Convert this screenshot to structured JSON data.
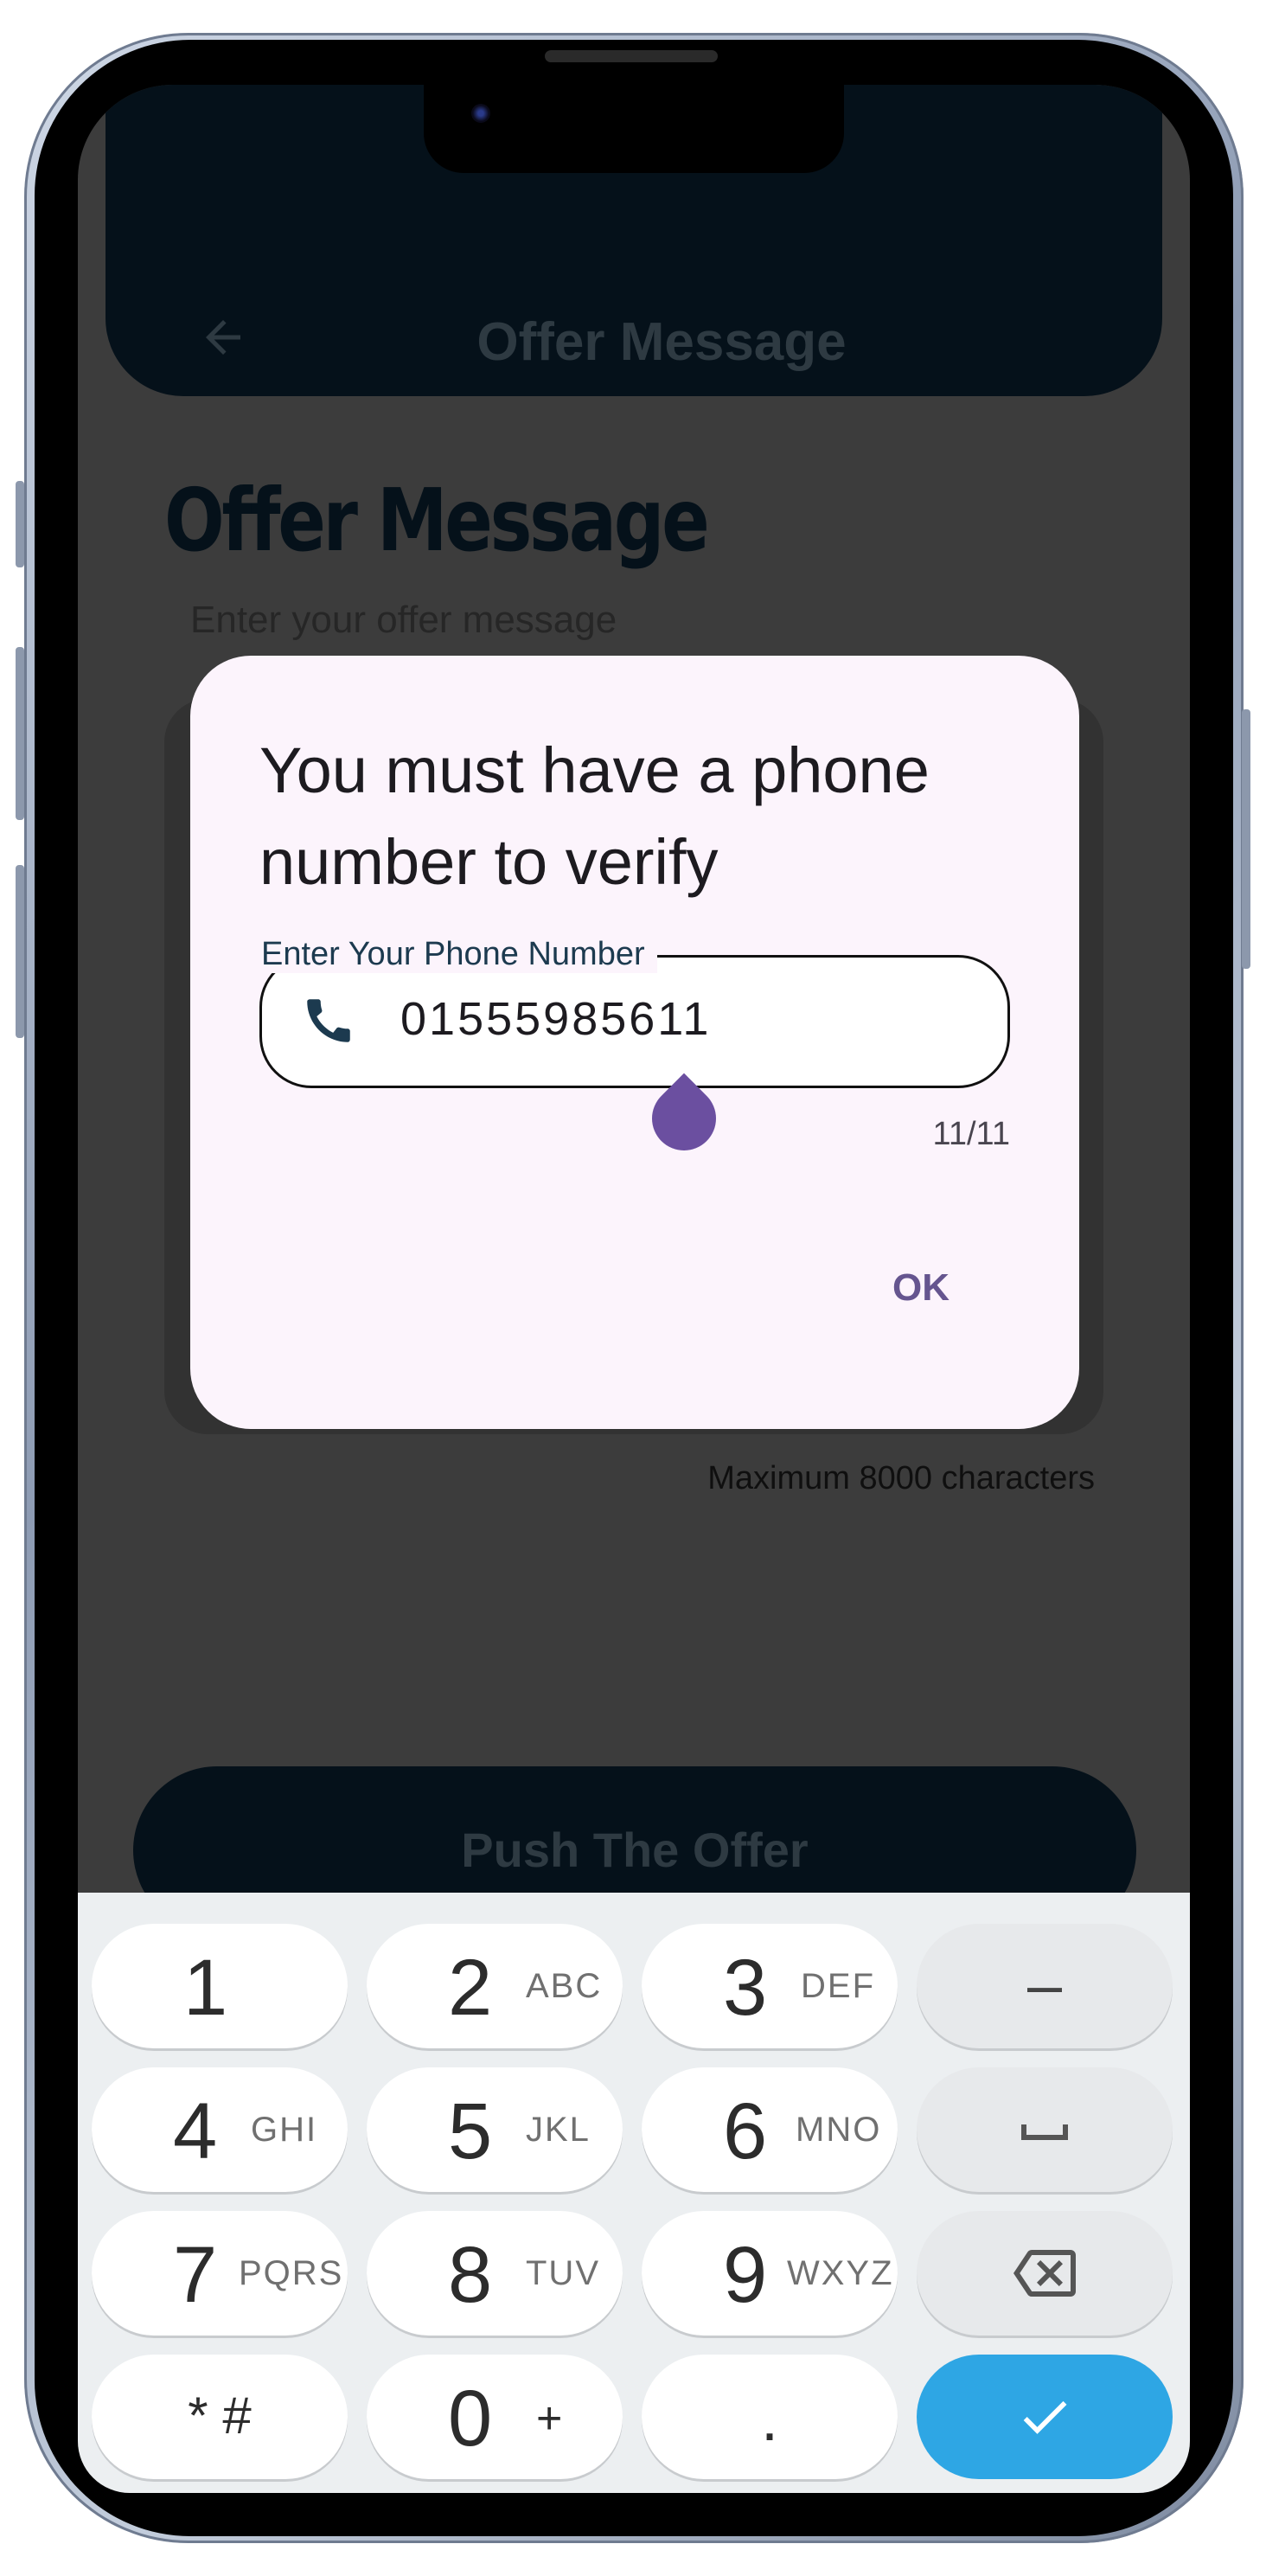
{
  "app": {
    "appbar_title": "Offer Message",
    "section_title": "Offer Message",
    "hint": "Enter your offer message",
    "max_chars": "Maximum 8000 characters",
    "push_button": "Push The Offer"
  },
  "dialog": {
    "title": "You must have a phone number to verify",
    "field_label": "Enter Your Phone Number",
    "phone_value": "01555985611",
    "counter": "11/11",
    "ok_label": "OK"
  },
  "keyboard": {
    "rows": [
      [
        {
          "num": "1",
          "letters": ""
        },
        {
          "num": "2",
          "letters": "ABC"
        },
        {
          "num": "3",
          "letters": "DEF"
        },
        {
          "sym": "–"
        }
      ],
      [
        {
          "num": "4",
          "letters": "GHI"
        },
        {
          "num": "5",
          "letters": "JKL"
        },
        {
          "num": "6",
          "letters": "MNO"
        },
        {
          "sym": "space"
        }
      ],
      [
        {
          "num": "7",
          "letters": "PQRS"
        },
        {
          "num": "8",
          "letters": "TUV"
        },
        {
          "num": "9",
          "letters": "WXYZ"
        },
        {
          "sym": "backspace"
        }
      ],
      [
        {
          "num": "* #",
          "letters": ""
        },
        {
          "num": "0",
          "letters": "+"
        },
        {
          "num": ".",
          "letters": ""
        },
        {
          "sym": "check"
        }
      ]
    ]
  },
  "colors": {
    "accent": "#65558f",
    "keyboard_action": "#2ea6e4",
    "dialog_bg": "#fcf4fc"
  }
}
